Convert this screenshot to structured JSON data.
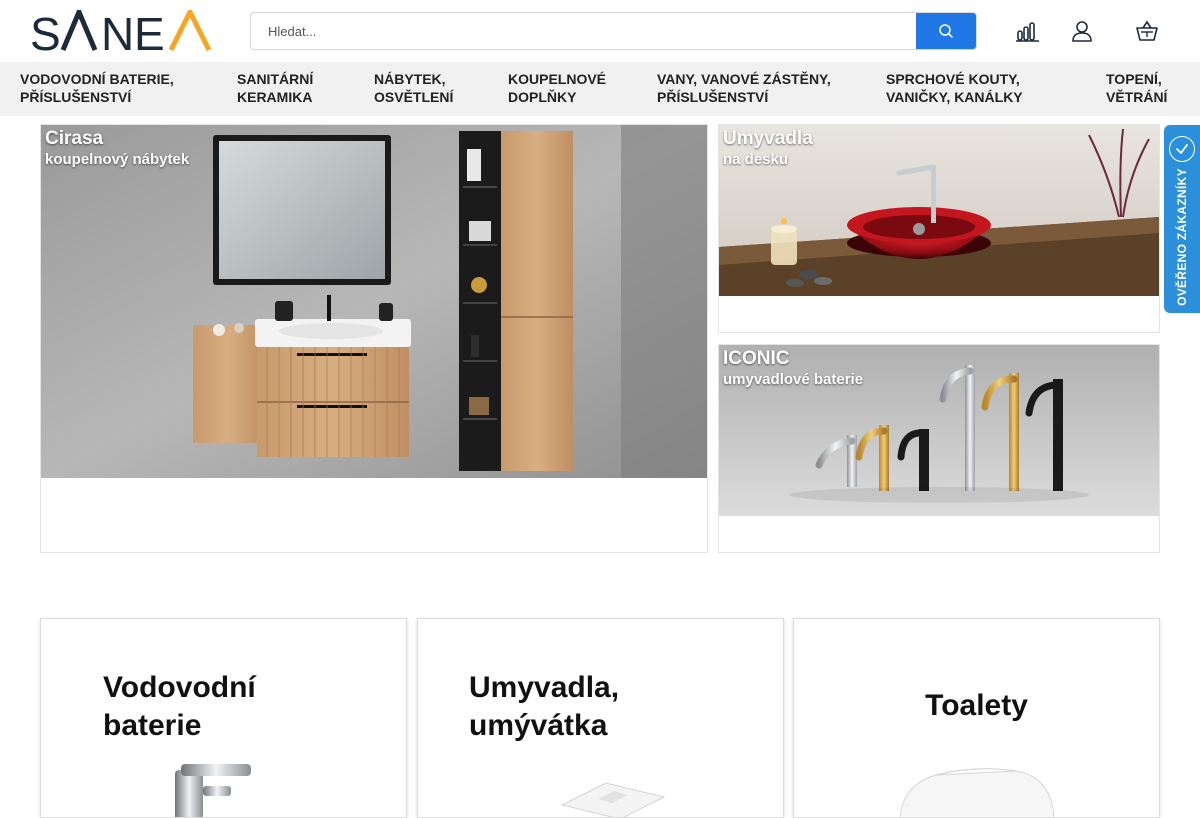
{
  "brand": {
    "logo_text": "SANEA",
    "accent": "#f5a623",
    "dark": "#1d2a3a"
  },
  "search": {
    "placeholder": "Hledat...",
    "button_icon": "search-icon",
    "button_color": "#1f78e6"
  },
  "header_icons": [
    "compare-chart-icon",
    "user-icon",
    "basket-icon"
  ],
  "nav": {
    "items": [
      {
        "line1": "Vodovodní baterie,",
        "line2": "příslušenství"
      },
      {
        "line1": "Sanitární",
        "line2": "keramika"
      },
      {
        "line1": "Nábytek,",
        "line2": "osvětlení"
      },
      {
        "line1": "Koupelnové",
        "line2": "doplňky"
      },
      {
        "line1": "Vany, vanové zástěny,",
        "line2": "příslušenství"
      },
      {
        "line1": "Sprchové kouty,",
        "line2": "vaničky, kanálky"
      },
      {
        "line1": "Topení,",
        "line2": "větrání"
      }
    ]
  },
  "banners": [
    {
      "title": "Cirasa",
      "subtitle": "koupelnový nábytek"
    },
    {
      "title": "Umyvadla",
      "subtitle": "na desku"
    },
    {
      "title": "ICONIC",
      "subtitle": "umyvadlové baterie"
    }
  ],
  "verified_badge": {
    "label": "OVĚŘENO ZÁKAZNÍKY",
    "color": "#2c8fd9"
  },
  "categories": [
    {
      "line1": "Vodovodní",
      "line2": "baterie"
    },
    {
      "line1": "Umyvadla,",
      "line2": "umývátka"
    },
    {
      "line1": "Toalety",
      "line2": ""
    }
  ]
}
